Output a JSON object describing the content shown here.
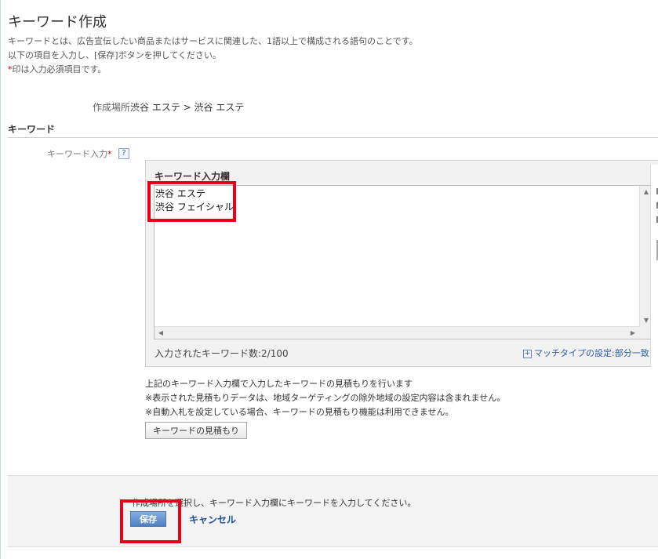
{
  "page": {
    "title": "キーワード作成",
    "intro_line1": "キーワードとは、広告宣伝したい商品またはサービスに関連した、1語以上で構成される語句のことです。",
    "intro_line2": "以下の項目を入力し、[保存]ボタンを押してください。",
    "intro_req_mark": "*",
    "intro_line3": "印は入力必須項目です。"
  },
  "location": {
    "label": "作成場所",
    "value": "渋谷 エステ > 渋谷 エステ"
  },
  "keyword_section": {
    "header": "キーワード",
    "field_label": "キーワード入力",
    "required_mark": "*",
    "help_icon": "?"
  },
  "editor": {
    "title": "キーワード入力欄",
    "keywords": [
      "渋谷 エステ",
      "渋谷 フェイシャル"
    ],
    "count_label": "入力されたキーワード数:",
    "count_value": "2/100",
    "match_type_icon": "+",
    "match_type_link": "マッチタイプの設定:部分一致"
  },
  "notes": {
    "line1": "上記のキーワード入力欄で入力したキーワードの見積もりを行います",
    "line2": "※表示された見積もりデータは、地域ターゲティングの除外地域の設定内容は含まれません。",
    "line3": "※自動入札を設定している場合、キーワードの見積もり機能は利用できません。",
    "estimate_button": "キーワードの見積もり"
  },
  "footer": {
    "message": "作成場所を選択し、キーワード入力欄にキーワードを入力してください。",
    "save_label": "保存",
    "cancel_label": "キャンセル"
  },
  "colors": {
    "highlight": "#e4001b",
    "link": "#1f4f9a",
    "save_button": "#5b88c8"
  }
}
